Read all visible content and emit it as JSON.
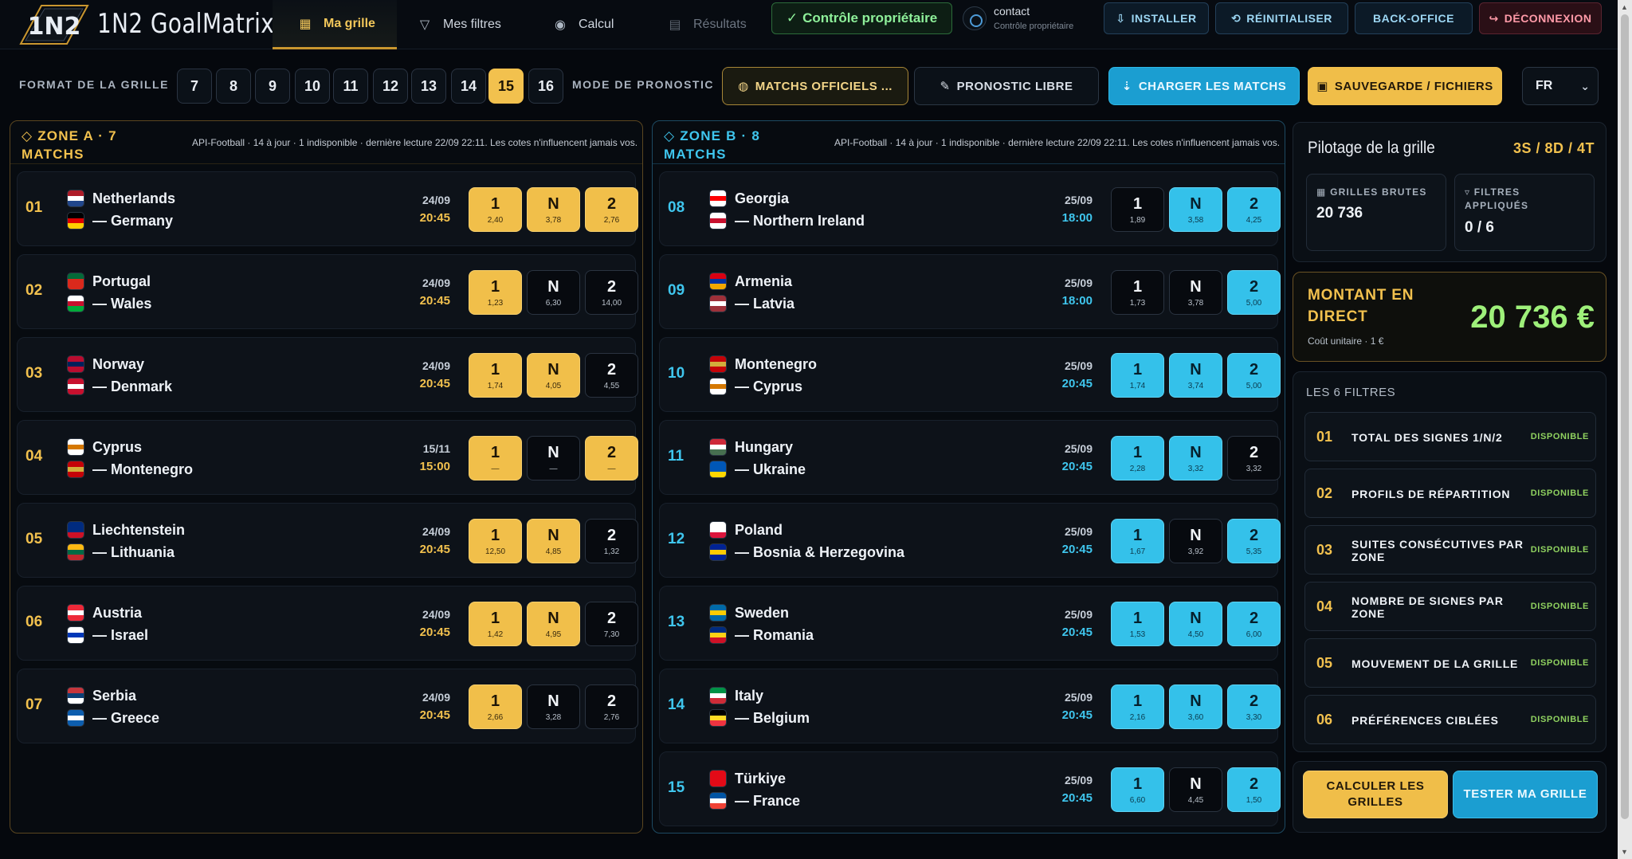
{
  "brand": {
    "name": "1N2 GoalMatrix",
    "mark": "1N2"
  },
  "nav": {
    "tabs": [
      {
        "label": "Ma grille",
        "icon": "grid-icon"
      },
      {
        "label": "Mes filtres",
        "icon": "filter-icon"
      },
      {
        "label": "Calcul",
        "icon": "circle-icon"
      },
      {
        "label": "Résultats",
        "icon": "table-icon"
      }
    ],
    "owner_check": "Contrôle propriétaire",
    "contact_name": "contact",
    "contact_role": "Contrôle propriétaire",
    "buttons": {
      "install": "INSTALLER",
      "reset": "RÉINITIALISER",
      "backoffice": "BACK-OFFICE",
      "logout": "DÉCONNEXION"
    }
  },
  "toolbar": {
    "format_label": "FORMAT DE LA GRILLE",
    "sizes": [
      "7",
      "8",
      "9",
      "10",
      "11",
      "12",
      "13",
      "14",
      "15",
      "16"
    ],
    "active_size": "15",
    "mode_label": "MODE DE PRONOSTIC",
    "officiel": "MATCHS OFFICIELS ...",
    "libre": "PRONOSTIC LIBRE",
    "charger": "CHARGER LES MATCHS",
    "sauvegarde": "SAUVEGARDE / FICHIERS",
    "lang": "FR"
  },
  "zones": {
    "a": {
      "title": "ZONE A · 7 MATCHS",
      "info": "API-Football · 14 à jour · 1 indisponible · dernière lecture 22/09 22:11. Les cotes n'influencent jamais vos...",
      "matches": [
        {
          "num": "01",
          "home": "Netherlands",
          "away": "— Germany",
          "date": "24/09",
          "time": "20:45",
          "odds": [
            "2,40",
            "3,78",
            "2,76"
          ],
          "sel": [
            true,
            true,
            true
          ]
        },
        {
          "num": "02",
          "home": "Portugal",
          "away": "— Wales",
          "date": "24/09",
          "time": "20:45",
          "odds": [
            "1,23",
            "6,30",
            "14,00"
          ],
          "sel": [
            true,
            false,
            false
          ]
        },
        {
          "num": "03",
          "home": "Norway",
          "away": "— Denmark",
          "date": "24/09",
          "time": "20:45",
          "odds": [
            "1,74",
            "4,05",
            "4,55"
          ],
          "sel": [
            true,
            true,
            false
          ]
        },
        {
          "num": "04",
          "home": "Cyprus",
          "away": "— Montenegro",
          "date": "15/11",
          "time": "15:00",
          "odds": [
            "—",
            "—",
            "—"
          ],
          "sel": [
            true,
            false,
            true
          ]
        },
        {
          "num": "05",
          "home": "Liechtenstein",
          "away": "— Lithuania",
          "date": "24/09",
          "time": "20:45",
          "odds": [
            "12,50",
            "4,85",
            "1,32"
          ],
          "sel": [
            true,
            true,
            false
          ]
        },
        {
          "num": "06",
          "home": "Austria",
          "away": "— Israel",
          "date": "24/09",
          "time": "20:45",
          "odds": [
            "1,42",
            "4,95",
            "7,30"
          ],
          "sel": [
            true,
            true,
            false
          ]
        },
        {
          "num": "07",
          "home": "Serbia",
          "away": "— Greece",
          "date": "24/09",
          "time": "20:45",
          "odds": [
            "2,66",
            "3,28",
            "2,76"
          ],
          "sel": [
            true,
            false,
            false
          ]
        }
      ]
    },
    "b": {
      "title": "ZONE B · 8 MATCHS",
      "info": "API-Football · 14 à jour · 1 indisponible · dernière lecture 22/09 22:11. Les cotes n'influencent jamais vos...",
      "matches": [
        {
          "num": "08",
          "home": "Georgia",
          "away": "— Northern Ireland",
          "date": "25/09",
          "time": "18:00",
          "odds": [
            "1,89",
            "3,58",
            "4,25"
          ],
          "sel": [
            false,
            true,
            true
          ]
        },
        {
          "num": "09",
          "home": "Armenia",
          "away": "— Latvia",
          "date": "25/09",
          "time": "18:00",
          "odds": [
            "1,73",
            "3,78",
            "5,00"
          ],
          "sel": [
            false,
            false,
            true
          ]
        },
        {
          "num": "10",
          "home": "Montenegro",
          "away": "— Cyprus",
          "date": "25/09",
          "time": "20:45",
          "odds": [
            "1,74",
            "3,74",
            "5,00"
          ],
          "sel": [
            true,
            true,
            true
          ]
        },
        {
          "num": "11",
          "home": "Hungary",
          "away": "— Ukraine",
          "date": "25/09",
          "time": "20:45",
          "odds": [
            "2,28",
            "3,32",
            "3,32"
          ],
          "sel": [
            true,
            true,
            false
          ]
        },
        {
          "num": "12",
          "home": "Poland",
          "away": "— Bosnia & Herzegovina",
          "date": "25/09",
          "time": "20:45",
          "odds": [
            "1,67",
            "3,92",
            "5,35"
          ],
          "sel": [
            true,
            false,
            true
          ]
        },
        {
          "num": "13",
          "home": "Sweden",
          "away": "— Romania",
          "date": "25/09",
          "time": "20:45",
          "odds": [
            "1,53",
            "4,50",
            "6,00"
          ],
          "sel": [
            true,
            true,
            true
          ]
        },
        {
          "num": "14",
          "home": "Italy",
          "away": "— Belgium",
          "date": "25/09",
          "time": "20:45",
          "odds": [
            "2,16",
            "3,60",
            "3,30"
          ],
          "sel": [
            true,
            true,
            true
          ]
        },
        {
          "num": "15",
          "home": "Türkiye",
          "away": "— France",
          "date": "25/09",
          "time": "20:45",
          "odds": [
            "6,60",
            "4,45",
            "1,50"
          ],
          "sel": [
            true,
            false,
            true
          ]
        }
      ]
    }
  },
  "flags": {
    "Netherlands": [
      "#ae1c28",
      "#ffffff",
      "#21468b"
    ],
    "Germany": [
      "#000000",
      "#dd0000",
      "#ffce00"
    ],
    "Portugal": [
      "#046a38",
      "#da291c",
      "#da291c"
    ],
    "Wales": [
      "#ffffff",
      "#c8102e",
      "#00ab39"
    ],
    "Norway": [
      "#ba0c2f",
      "#00205b",
      "#ba0c2f"
    ],
    "Denmark": [
      "#c8102e",
      "#ffffff",
      "#c8102e"
    ],
    "Cyprus": [
      "#ffffff",
      "#d57800",
      "#ffffff"
    ],
    "Montenegro": [
      "#c40308",
      "#d3ae3b",
      "#c40308"
    ],
    "Liechtenstein": [
      "#002b7f",
      "#002b7f",
      "#ce1126"
    ],
    "Lithuania": [
      "#fdb913",
      "#006a44",
      "#c1272d"
    ],
    "Austria": [
      "#ed2939",
      "#ffffff",
      "#ed2939"
    ],
    "Israel": [
      "#ffffff",
      "#0038b8",
      "#ffffff"
    ],
    "Serbia": [
      "#c6363c",
      "#0c4076",
      "#ffffff"
    ],
    "Greece": [
      "#0d5eaf",
      "#ffffff",
      "#0d5eaf"
    ],
    "Georgia": [
      "#ffffff",
      "#ff0000",
      "#ffffff"
    ],
    "Northern Ireland": [
      "#ffffff",
      "#c8102e",
      "#ffffff"
    ],
    "Armenia": [
      "#d90012",
      "#0033a0",
      "#f2a800"
    ],
    "Latvia": [
      "#9e3039",
      "#ffffff",
      "#9e3039"
    ],
    "Hungary": [
      "#ce2939",
      "#ffffff",
      "#477050"
    ],
    "Ukraine": [
      "#0057b7",
      "#0057b7",
      "#ffd700"
    ],
    "Poland": [
      "#ffffff",
      "#ffffff",
      "#dc143c"
    ],
    "Bosnia & Herzegovina": [
      "#002395",
      "#fecb00",
      "#002395"
    ],
    "Sweden": [
      "#006aa7",
      "#fecc00",
      "#006aa7"
    ],
    "Romania": [
      "#002b7f",
      "#fcd116",
      "#ce1126"
    ],
    "Italy": [
      "#009246",
      "#ffffff",
      "#ce2b37"
    ],
    "Belgium": [
      "#000000",
      "#fdda24",
      "#ef3340"
    ],
    "Türkiye": [
      "#e30a17",
      "#e30a17",
      "#e30a17"
    ],
    "France": [
      "#0055a4",
      "#ffffff",
      "#ef4135"
    ]
  },
  "pilotage": {
    "title": "Pilotage de la grille",
    "format": "3S / 8D / 4T",
    "brutes_label": "GRILLES BRUTES",
    "brutes_value": "20 736",
    "filtres_label": "FILTRES APPLIQUÉS",
    "filtres_value": "0 / 6"
  },
  "montant": {
    "title": "MONTANT EN DIRECT",
    "unit_cost": "Coût unitaire · 1 €",
    "amount": "20 736 €"
  },
  "filters": {
    "heading": "LES 6 FILTRES",
    "items": [
      {
        "num": "01",
        "label": "TOTAL DES SIGNES 1/N/2",
        "status": "DISPONIBLE"
      },
      {
        "num": "02",
        "label": "PROFILS DE RÉPARTITION",
        "status": "DISPONIBLE"
      },
      {
        "num": "03",
        "label": "SUITES CONSÉCUTIVES PAR ZONE",
        "status": "DISPONIBLE"
      },
      {
        "num": "04",
        "label": "NOMBRE DE SIGNES PAR ZONE",
        "status": "DISPONIBLE"
      },
      {
        "num": "05",
        "label": "MOUVEMENT DE LA GRILLE",
        "status": "DISPONIBLE"
      },
      {
        "num": "06",
        "label": "PRÉFÉRENCES CIBLÉES",
        "status": "DISPONIBLE"
      }
    ]
  },
  "actions": {
    "calculer": "CALCULER LES GRILLES",
    "tester": "TESTER MA GRILLE"
  },
  "colors": {
    "gold": "#f2c14e",
    "cyan": "#3fc6ee",
    "green": "#9ef07a",
    "background": "#05080d"
  }
}
